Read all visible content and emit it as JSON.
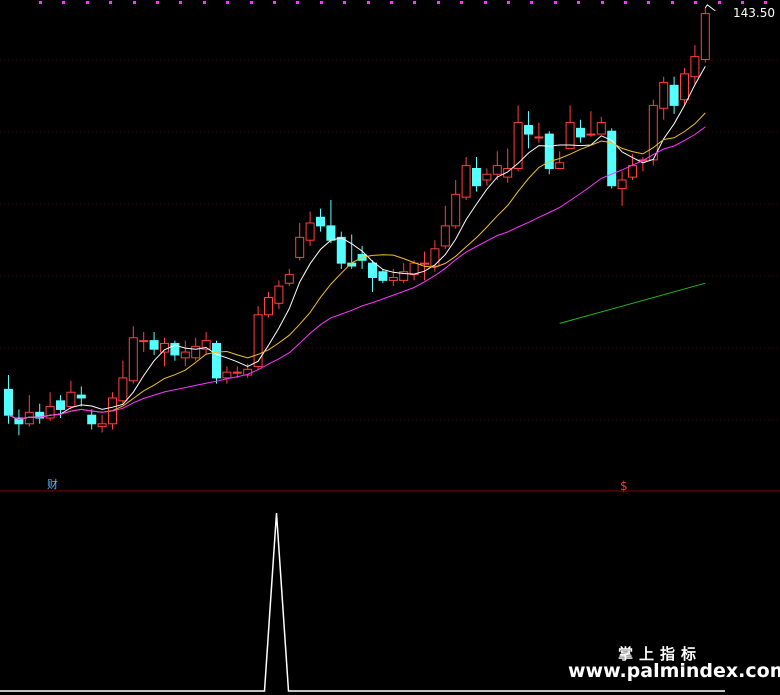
{
  "chart_data": {
    "type": "candlestick",
    "price_label": "143.50",
    "markers": {
      "buy_label": "财",
      "sell_label": "$"
    },
    "colors": {
      "background": "#000000",
      "up": "#ff4040",
      "down": "#54ffff",
      "ma_short": "#ffffff",
      "ma_mid": "#f0c020",
      "ma_long": "#ff33ff",
      "ma_longest": "#22bb22",
      "divider": "#8a0000",
      "grid": "#3a0000",
      "top_dot": "#ff33ff",
      "indicator": "#ffffff"
    },
    "candles": [
      [
        113.0,
        108.5,
        115.5,
        107.0
      ],
      [
        108.0,
        107.0,
        109.5,
        105.0
      ],
      [
        107.0,
        109.0,
        112.0,
        106.5
      ],
      [
        109.0,
        108.0,
        110.5,
        107.0
      ],
      [
        108.0,
        110.0,
        112.5,
        107.5
      ],
      [
        111.0,
        109.5,
        112.0,
        108.0
      ],
      [
        110.0,
        112.5,
        114.5,
        109.5
      ],
      [
        112.0,
        111.5,
        113.5,
        110.0
      ],
      [
        108.5,
        107.0,
        109.5,
        106.0
      ],
      [
        106.5,
        107.0,
        108.5,
        105.5
      ],
      [
        107.0,
        111.5,
        112.5,
        106.0
      ],
      [
        111.0,
        115.0,
        118.0,
        110.5
      ],
      [
        114.5,
        122.0,
        124.0,
        114.0
      ],
      [
        121.5,
        121.5,
        123.0,
        119.5
      ],
      [
        121.5,
        120.0,
        123.0,
        119.0
      ],
      [
        119.5,
        121.0,
        122.0,
        117.0
      ],
      [
        121.0,
        119.0,
        121.5,
        118.0
      ],
      [
        118.5,
        119.5,
        121.5,
        117.0
      ],
      [
        118.5,
        120.5,
        122.0,
        118.0
      ],
      [
        120.0,
        121.5,
        123.0,
        119.0
      ],
      [
        121.0,
        115.0,
        121.5,
        114.0
      ],
      [
        115.0,
        116.0,
        117.0,
        114.0
      ],
      [
        116.0,
        116.0,
        117.0,
        115.0
      ],
      [
        115.5,
        116.5,
        117.5,
        115.0
      ],
      [
        117.0,
        126.0,
        127.5,
        116.5
      ],
      [
        126.0,
        129.0,
        130.0,
        125.5
      ],
      [
        128.0,
        131.0,
        132.0,
        127.0
      ],
      [
        131.5,
        133.0,
        134.0,
        131.0
      ],
      [
        136.0,
        139.5,
        142.0,
        135.5
      ],
      [
        139.0,
        142.0,
        144.0,
        138.0
      ],
      [
        143.0,
        141.5,
        144.5,
        140.5
      ],
      [
        141.5,
        139.0,
        146.0,
        138.5
      ],
      [
        139.5,
        135.0,
        140.5,
        134.0
      ],
      [
        135.0,
        134.5,
        140.0,
        134.0
      ],
      [
        136.5,
        135.5,
        138.0,
        134.0
      ],
      [
        135.0,
        132.5,
        135.5,
        130.0
      ],
      [
        133.5,
        132.0,
        134.0,
        131.5
      ],
      [
        132.0,
        132.5,
        134.0,
        131.0
      ],
      [
        132.0,
        133.5,
        135.0,
        131.5
      ],
      [
        133.0,
        135.0,
        135.5,
        132.0
      ],
      [
        135.0,
        135.0,
        137.0,
        132.0
      ],
      [
        134.5,
        137.5,
        139.0,
        133.5
      ],
      [
        138.0,
        141.5,
        145.0,
        137.5
      ],
      [
        141.5,
        147.0,
        149.5,
        141.0
      ],
      [
        146.5,
        152.0,
        153.5,
        146.0
      ],
      [
        151.5,
        148.5,
        153.5,
        147.5
      ],
      [
        149.5,
        150.5,
        151.5,
        148.5
      ],
      [
        150.5,
        152.0,
        154.5,
        149.5
      ],
      [
        150.0,
        151.5,
        155.0,
        149.0
      ],
      [
        151.5,
        159.5,
        162.5,
        151.0
      ],
      [
        159.0,
        157.5,
        161.5,
        155.0
      ],
      [
        157.0,
        157.0,
        159.5,
        156.0
      ],
      [
        157.5,
        151.5,
        158.0,
        150.5
      ],
      [
        151.5,
        152.5,
        154.5,
        152.0
      ],
      [
        155.0,
        159.5,
        162.5,
        155.0
      ],
      [
        158.5,
        157.0,
        160.0,
        156.0
      ],
      [
        157.5,
        157.5,
        161.5,
        157.0
      ],
      [
        157.5,
        159.5,
        160.5,
        157.5
      ],
      [
        158.0,
        148.5,
        158.5,
        148.0
      ],
      [
        148.0,
        149.5,
        151.0,
        145.0
      ],
      [
        150.0,
        152.0,
        154.0,
        149.5
      ],
      [
        153.0,
        153.0,
        153.5,
        151.0
      ],
      [
        153.0,
        162.5,
        163.5,
        152.0
      ],
      [
        162.0,
        166.5,
        167.5,
        160.0
      ],
      [
        166.0,
        162.5,
        167.5,
        161.0
      ],
      [
        163.5,
        168.0,
        169.0,
        162.5
      ],
      [
        167.5,
        171.0,
        173.0,
        166.0
      ],
      [
        170.5,
        178.5,
        179.5,
        170.0
      ]
    ],
    "ma_longest": [
      [
        53,
        124.5
      ],
      [
        60,
        128.0
      ],
      [
        67,
        131.5
      ]
    ],
    "indicator": {
      "spike_index": 25,
      "spike_value": 1.0,
      "baseline": 0.0
    }
  },
  "watermark": {
    "cn": "掌上指标",
    "url": "www.palmindex.com"
  }
}
